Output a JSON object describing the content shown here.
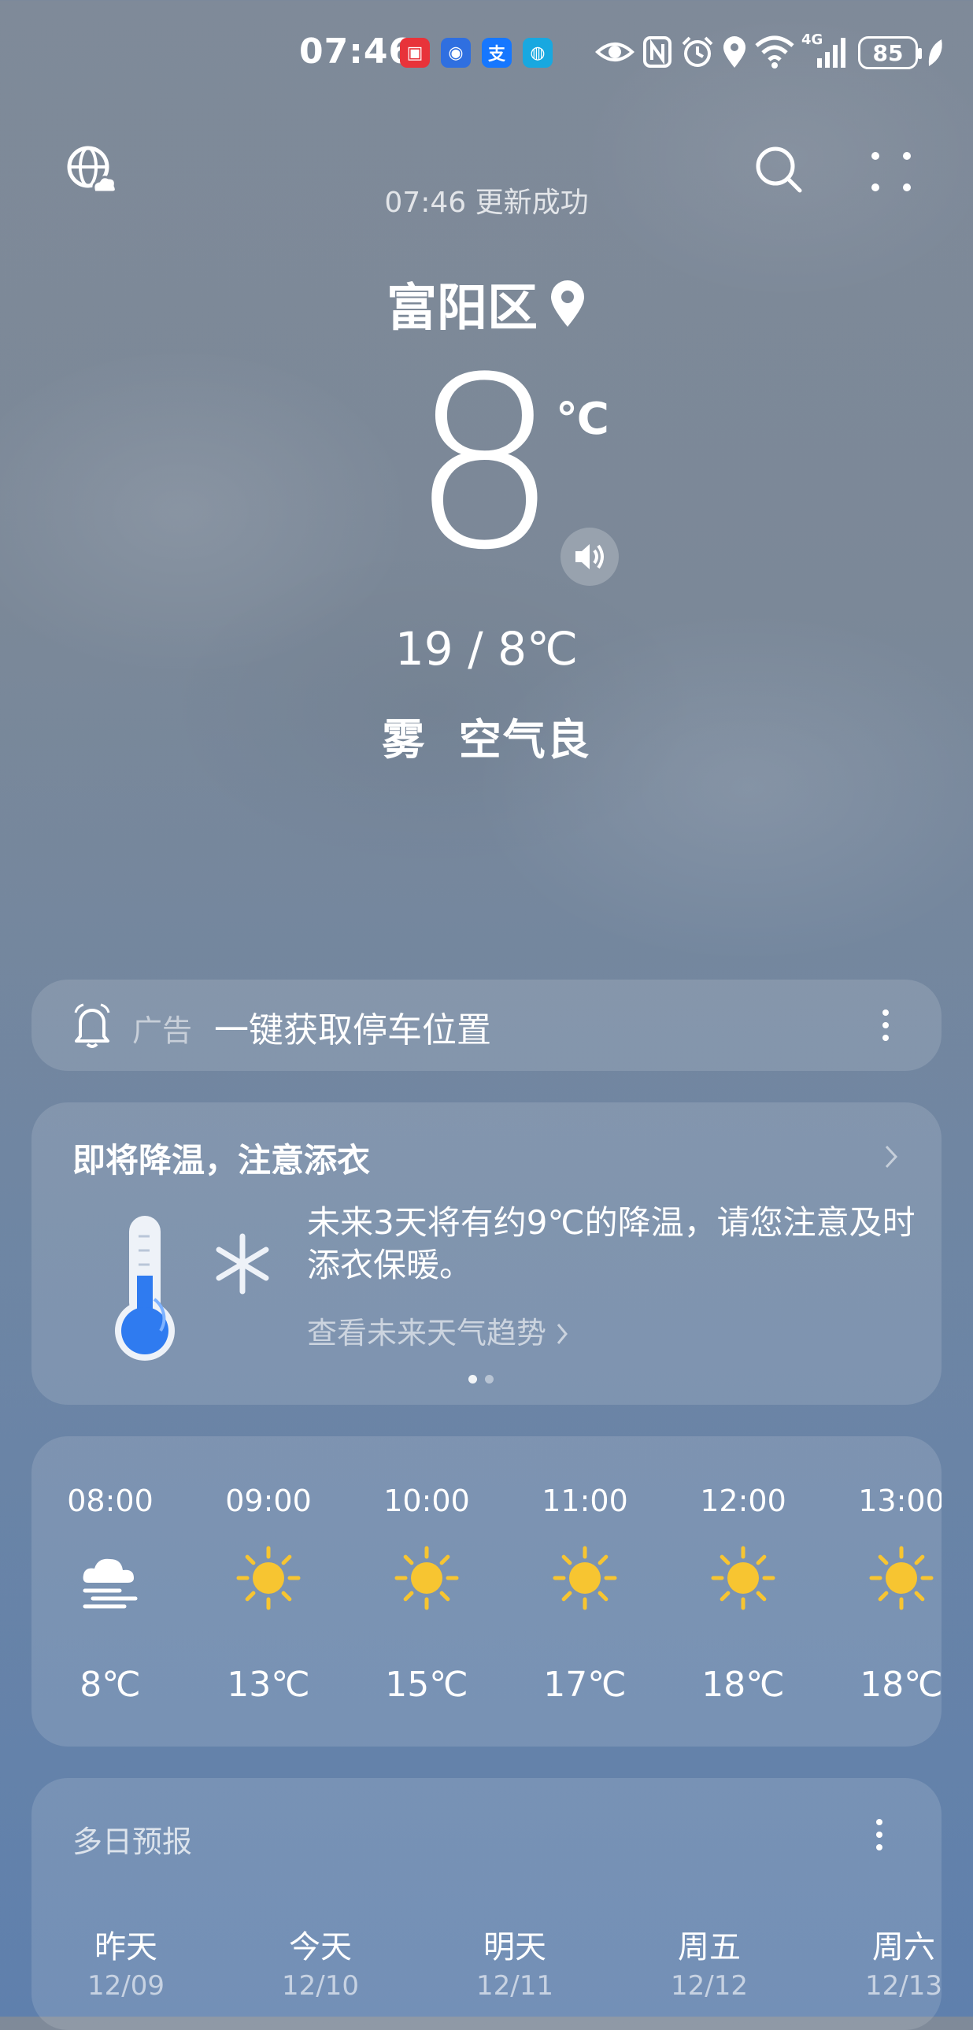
{
  "status_bar": {
    "time": "07:46",
    "apps": [
      {
        "name": "red-app-icon",
        "glyph": "▣",
        "color": "#e8333a"
      },
      {
        "name": "blue-app-icon",
        "glyph": "◉",
        "color": "#2f6fe0"
      },
      {
        "name": "alipay-icon",
        "glyph": "支",
        "color": "#1677ff"
      },
      {
        "name": "browser-icon",
        "glyph": "◍",
        "color": "#18a8e0"
      }
    ],
    "network": "4G",
    "battery": "85"
  },
  "header": {
    "update_text": "07:46 更新成功"
  },
  "current": {
    "city": "富阳区",
    "temperature": "8",
    "unit": "℃",
    "range": "19 / 8℃",
    "condition": "雾  空气良"
  },
  "ad": {
    "label": "广告",
    "text": "一键获取停车位置"
  },
  "alert": {
    "title": "即将降温，注意添衣",
    "body": "未来3天将有约9℃的降温，请您注意及时添衣保暖。",
    "link": "查看未来天气趋势",
    "page_count": 2,
    "active_page": 0
  },
  "hourly": [
    {
      "time": "08:00",
      "icon": "fog-cloud-icon",
      "temp": "8℃"
    },
    {
      "time": "09:00",
      "icon": "sun-icon",
      "temp": "13℃"
    },
    {
      "time": "10:00",
      "icon": "sun-icon",
      "temp": "15℃"
    },
    {
      "time": "11:00",
      "icon": "sun-icon",
      "temp": "17℃"
    },
    {
      "time": "12:00",
      "icon": "sun-icon",
      "temp": "18℃"
    },
    {
      "time": "13:00",
      "icon": "sun-icon",
      "temp": "18℃"
    }
  ],
  "multi_day": {
    "title": "多日预报",
    "days": [
      {
        "name": "昨天",
        "date": "12/09"
      },
      {
        "name": "今天",
        "date": "12/10"
      },
      {
        "name": "明天",
        "date": "12/11"
      },
      {
        "name": "周五",
        "date": "12/12"
      },
      {
        "name": "周六",
        "date": "12/13"
      }
    ]
  },
  "colors": {
    "sun": "#f7c531",
    "thermo_blue": "#2f7bf0"
  }
}
